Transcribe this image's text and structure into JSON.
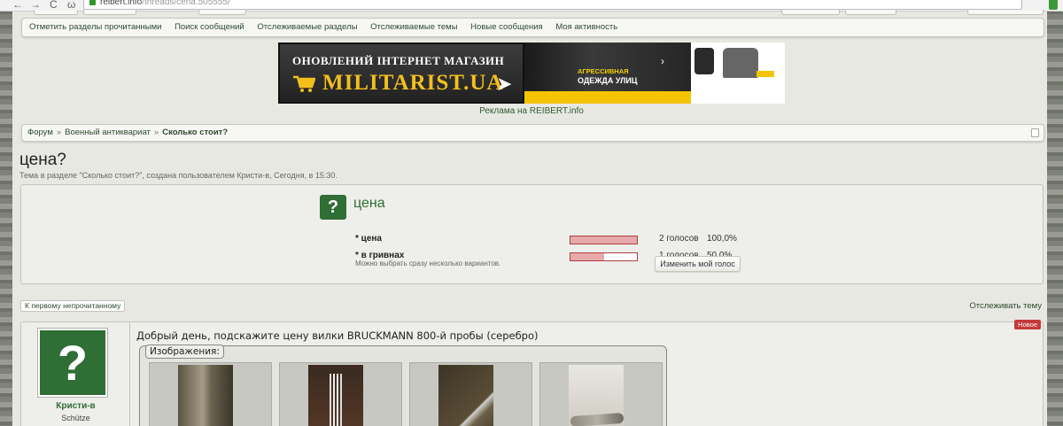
{
  "browser": {
    "nav_back": "←",
    "nav_forward": "→",
    "nav_reload": "C",
    "nav_home": "ω",
    "url_host": "reibert.info",
    "url_path": "/threads/cena.505555/"
  },
  "subnav": {
    "items": [
      "Отметить разделы прочитанными",
      "Поиск сообщений",
      "Отслеживаемые разделы",
      "Отслеживаемые темы",
      "Новые сообщения",
      "Моя активность"
    ]
  },
  "banner": {
    "slogan": "ОНОВЛЕНИЙ ІНТЕРНЕТ МАГАЗИН",
    "brand": "MILITARIST.UA",
    "mid_label": "АГРЕССИВНАЯ",
    "mid_label2": "ОДЕЖДА УЛИЦ",
    "caption": "Реклама на REIBERT.info"
  },
  "breadcrumb": {
    "items": [
      "Форум",
      "Военный антиквариат"
    ],
    "separator": "»",
    "current": "Сколько стоит?"
  },
  "thread": {
    "title": "цена?",
    "meta": "Тема в разделе \"Сколько стоит?\", создана пользователем Кристи-в, Сегодня, в 15:30."
  },
  "poll": {
    "question": "цена",
    "icon_glyph": "?",
    "options": [
      {
        "label": "* цена",
        "votes": "2 голосов",
        "percent": "100,0%",
        "fill": 100
      },
      {
        "label": "* в гривнах",
        "votes": "1 голосов",
        "percent": "50,0%",
        "fill": 50
      }
    ],
    "note": "Можно выбрать сразу несколько вариантов.",
    "change_button": "Изменить мой голос"
  },
  "thread_actions": {
    "jump_unread": "К первому непрочитанному",
    "watch": "Отслеживать тему"
  },
  "post": {
    "username": "Кристи-в",
    "user_title": "Schütze",
    "avatar_glyph": "?",
    "message": "Добрый день, подскажите цену вилки BRUCKMANN 800-й пробы (серебро)",
    "new_badge": "Новое",
    "attachments_label": "Изображения:"
  },
  "colors": {
    "accent_green": "#2f6e35",
    "link_green": "#2e4a2e",
    "poll_bar_border": "#b04040",
    "poll_bar_fill": "#e7a9a9",
    "new_badge": "#c43a3a",
    "banner_yellow": "#f3bf1d"
  },
  "icons": {
    "rss": "rss-icon",
    "cart": "cart-icon",
    "lock": "lock-icon"
  }
}
